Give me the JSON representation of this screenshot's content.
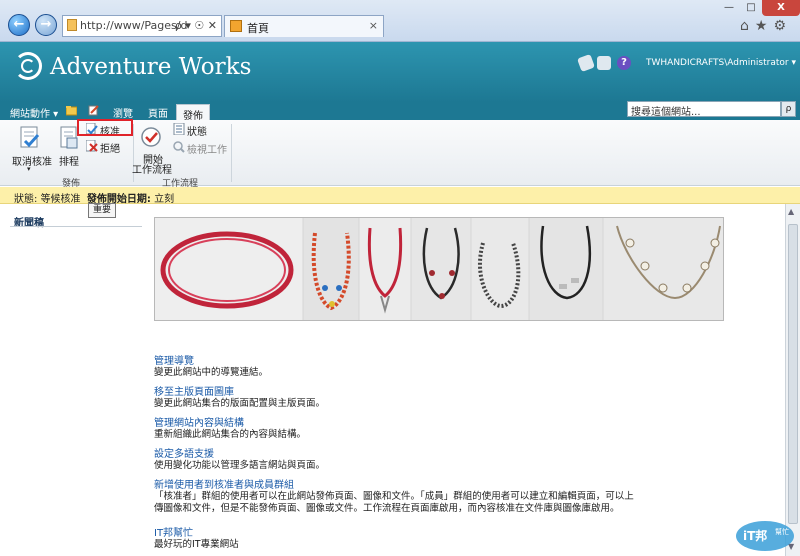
{
  "browser": {
    "address": "http://www/Pages/d",
    "address_tools": "ρ ▾ ☉ ✕",
    "tab_title": "首頁",
    "tab_close": "×",
    "nav_back": "←",
    "nav_forward": "→",
    "win_min": "—",
    "win_max": "□",
    "win_close": "X",
    "right_icons": "⌂★⚙"
  },
  "header": {
    "site_title": "Adventure Works",
    "user": "TWHANDICRAFTS\\Administrator ▾",
    "help": "?"
  },
  "tabs": {
    "site_actions": "網站動作 ▾",
    "browse": "瀏覽",
    "page": "頁面",
    "publish": "發佈"
  },
  "search": {
    "placeholder": "搜尋這個網站...",
    "button": "ρ"
  },
  "ribbon": {
    "cancel_approval": "取消核准",
    "cancel_arrow": "▾",
    "schedule": "排程",
    "approve": "核准",
    "reject": "拒絕",
    "publish_group": "發佈",
    "start_workflow_1": "開始",
    "start_workflow_2": "工作流程",
    "status": "狀態",
    "view_tasks": "檢視工作",
    "workflow_group": "工作流程"
  },
  "status_bar": {
    "status_label": "狀態:",
    "status_value": "等候核准",
    "start_label": "發佈開始日期:",
    "start_value": "立刻"
  },
  "tooltip": "重要",
  "left_nav": {
    "title": "新聞稿"
  },
  "links": [
    {
      "title": "管理導覽",
      "desc": "變更此網站中的導覽連結。"
    },
    {
      "title": "移至主版頁面圖庫",
      "desc": "變更此網站集合的版面配置與主版頁面。"
    },
    {
      "title": "管理網站內容與結構",
      "desc": "重新組織此網站集合的內容與結構。"
    },
    {
      "title": "設定多語支援",
      "desc": "使用變化功能以管理多語言網站與頁面。"
    },
    {
      "title": "新增使用者到核准者與成員群組",
      "desc": "「核准者」群組的使用者可以在此網站發佈頁面、圖像和文件。「成員」群組的使用者可以建立和編輯頁面，可以上傳圖像和文件，但是不能發佈頁面、圖像或文件。工作流程在頁面庫啟用，而內容核准在文件庫與圖像庫啟用。"
    },
    {
      "title": "IT邦幫忙",
      "desc": "最好玩的IT專業網站"
    }
  ],
  "watermark": {
    "line1": "iT邦",
    "line2": "幫忙"
  },
  "colors": {
    "header": "#1d7893",
    "link": "#1a5aa7",
    "status_bg": "#fdf0a9",
    "highlight": "#e0232a"
  }
}
